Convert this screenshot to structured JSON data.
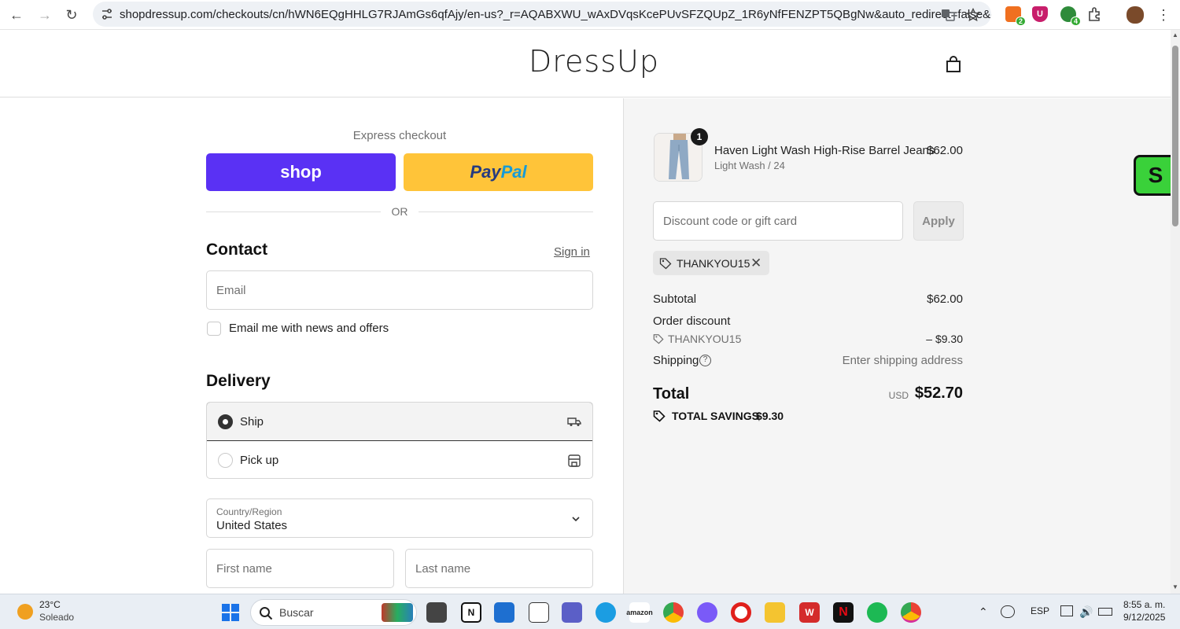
{
  "browser": {
    "url": "shopdressup.com/checkouts/cn/hWN6EQgHHLG7RJAmGs6qfAjy/en-us?_r=AQABXWU_wAxDVqsKcePUvSFZQUpZ_1R6yNfFENZPT5QBgNw&auto_redirect=false&edge_re...",
    "extensions": [
      {
        "name": "extension-1",
        "badge": "2",
        "color": "#f07020"
      },
      {
        "name": "ublock",
        "badge": "",
        "color": "#c81e6b"
      },
      {
        "name": "extension-3",
        "badge": "4",
        "color": "#2e8b3a"
      }
    ]
  },
  "shop": {
    "logo": "DressUp"
  },
  "checkout": {
    "express_title": "Express checkout",
    "shop_pay_label": "shop",
    "paypal_label_a": "Pay",
    "paypal_label_b": "Pal",
    "or_label": "OR",
    "contact_title": "Contact",
    "sign_in": "Sign in",
    "email_placeholder": "Email",
    "newsletter_label": "Email me with news and offers",
    "delivery_title": "Delivery",
    "delivery_options": [
      {
        "label": "Ship",
        "selected": true
      },
      {
        "label": "Pick up",
        "selected": false
      }
    ],
    "country_label": "Country/Region",
    "country_value": "United States",
    "first_name_placeholder": "First name",
    "last_name_placeholder": "Last name"
  },
  "summary": {
    "product": {
      "quantity": "1",
      "name": "Haven Light Wash High-Rise Barrel Jeans",
      "variant": "Light Wash / 24",
      "price": "$62.00"
    },
    "discount_placeholder": "Discount code or gift card",
    "apply_label": "Apply",
    "applied_code": "THANKYOU15",
    "subtotal_label": "Subtotal",
    "subtotal_value": "$62.00",
    "order_discount_label": "Order discount",
    "discount_code": "THANKYOU15",
    "discount_value": "– $9.30",
    "shipping_label": "Shipping",
    "shipping_value": "Enter shipping address",
    "total_label": "Total",
    "currency": "USD",
    "total_value": "$52.70",
    "savings_label": "TOTAL SAVINGS",
    "savings_value": "$9.30",
    "floating_shop_badge": "S"
  },
  "taskbar": {
    "temperature": "23°C",
    "weather": "Soleado",
    "search_placeholder": "Buscar",
    "language": "ESP",
    "time": "8:55 a. m.",
    "date": "9/12/2025",
    "apps": [
      {
        "name": "windows-start-icon",
        "color": "#1a73e8",
        "label": ""
      },
      {
        "name": "task-view-icon",
        "color": "#333333",
        "label": ""
      },
      {
        "name": "notion-icon",
        "color": "#111111",
        "label": "N"
      },
      {
        "name": "microsoft-store-icon",
        "color": "#1e6fd0",
        "label": ""
      },
      {
        "name": "file-icon",
        "color": "#ffffff",
        "label": ""
      },
      {
        "name": "teams-icon",
        "color": "#5b5fc7",
        "label": ""
      },
      {
        "name": "edge-icon",
        "color": "#1b9de2",
        "label": ""
      },
      {
        "name": "amazon-icon",
        "color": "#222222",
        "label": "amazon"
      },
      {
        "name": "chrome-icon",
        "color": "#34a853",
        "label": ""
      },
      {
        "name": "copilot-icon",
        "color": "#7a5af8",
        "label": ""
      },
      {
        "name": "opera-icon",
        "color": "#e0201c",
        "label": ""
      },
      {
        "name": "file-explorer-icon",
        "color": "#f4c430",
        "label": ""
      },
      {
        "name": "wps-office-icon",
        "color": "#d42b2b",
        "label": "W"
      },
      {
        "name": "netflix-icon",
        "color": "#e50914",
        "label": "N"
      },
      {
        "name": "spotify-icon",
        "color": "#1db954",
        "label": ""
      },
      {
        "name": "chrome-profile-icon",
        "color": "#4285f4",
        "label": ""
      }
    ]
  }
}
